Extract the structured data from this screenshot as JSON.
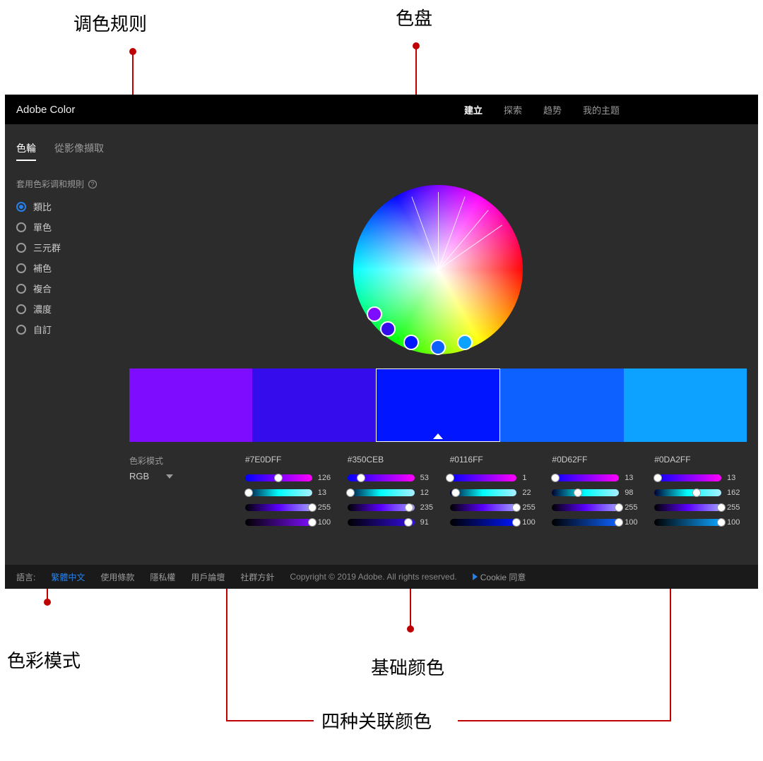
{
  "annotations": {
    "rule": "调色规则",
    "wheel": "色盘",
    "mode": "色彩模式",
    "base": "基础颜色",
    "related": "四种关联颜色"
  },
  "header": {
    "brand": "Adobe Color",
    "nav": [
      "建立",
      "探索",
      "趋势",
      "我的主题"
    ],
    "nav_active": 0
  },
  "sub_tabs": {
    "items": [
      "色輪",
      "從影像擷取"
    ],
    "active": 0
  },
  "rules": {
    "label": "套用色彩调和規則",
    "items": [
      "類比",
      "單色",
      "三元群",
      "補色",
      "複合",
      "濃度",
      "自訂"
    ],
    "selected": 0
  },
  "mode": {
    "label": "色彩模式",
    "value": "RGB"
  },
  "swatches": [
    {
      "hex": "#7E0DFF",
      "rgb": [
        126,
        13,
        255
      ],
      "base": false
    },
    {
      "hex": "#350CEB",
      "rgb": [
        53,
        12,
        235
      ],
      "base": false
    },
    {
      "hex": "#0116FF",
      "rgb": [
        1,
        22,
        255
      ],
      "base": true
    },
    {
      "hex": "#0D62FF",
      "rgb": [
        13,
        98,
        255
      ],
      "base": false
    },
    {
      "hex": "#0DA2FF",
      "rgb": [
        13,
        162,
        255
      ],
      "base": false
    }
  ],
  "slider_extra": [
    100,
    91,
    100,
    100,
    100
  ],
  "footer": {
    "lang_label": "語言:",
    "lang_value": "繁體中文",
    "links": [
      "使用條款",
      "隱私權",
      "用戶論壇",
      "社群方針"
    ],
    "copyright": "Copyright © 2019 Adobe. All rights reserved.",
    "cookie": "Cookie 同意"
  }
}
